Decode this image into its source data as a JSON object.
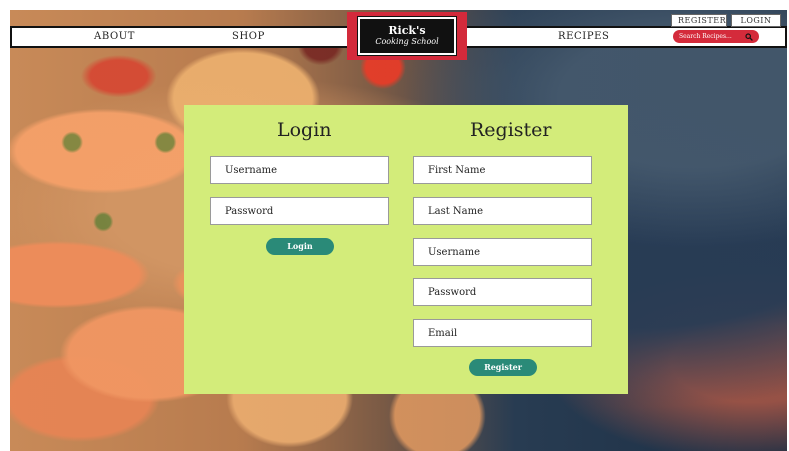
{
  "header": {
    "account_links": {
      "register": "REGISTER",
      "login": "LOGIN"
    },
    "nav": {
      "about": "ABOUT",
      "shop": "SHOP",
      "recipes": "RECIPES"
    },
    "search": {
      "placeholder": "Search Recipes..."
    }
  },
  "logo": {
    "title": "Rick's",
    "subtitle": "Cooking School"
  },
  "login": {
    "title": "Login",
    "fields": [
      {
        "label": "Username"
      },
      {
        "label": "Password"
      }
    ],
    "button": "Login"
  },
  "register": {
    "title": "Register",
    "fields": [
      {
        "label": "First Name"
      },
      {
        "label": "Last Name"
      },
      {
        "label": "Username"
      },
      {
        "label": "Password"
      },
      {
        "label": "Email"
      }
    ],
    "button": "Register"
  },
  "colors": {
    "panel_bg": "#d3ec7a",
    "accent_red": "#d32a3b",
    "button_teal": "#2a8a78"
  }
}
